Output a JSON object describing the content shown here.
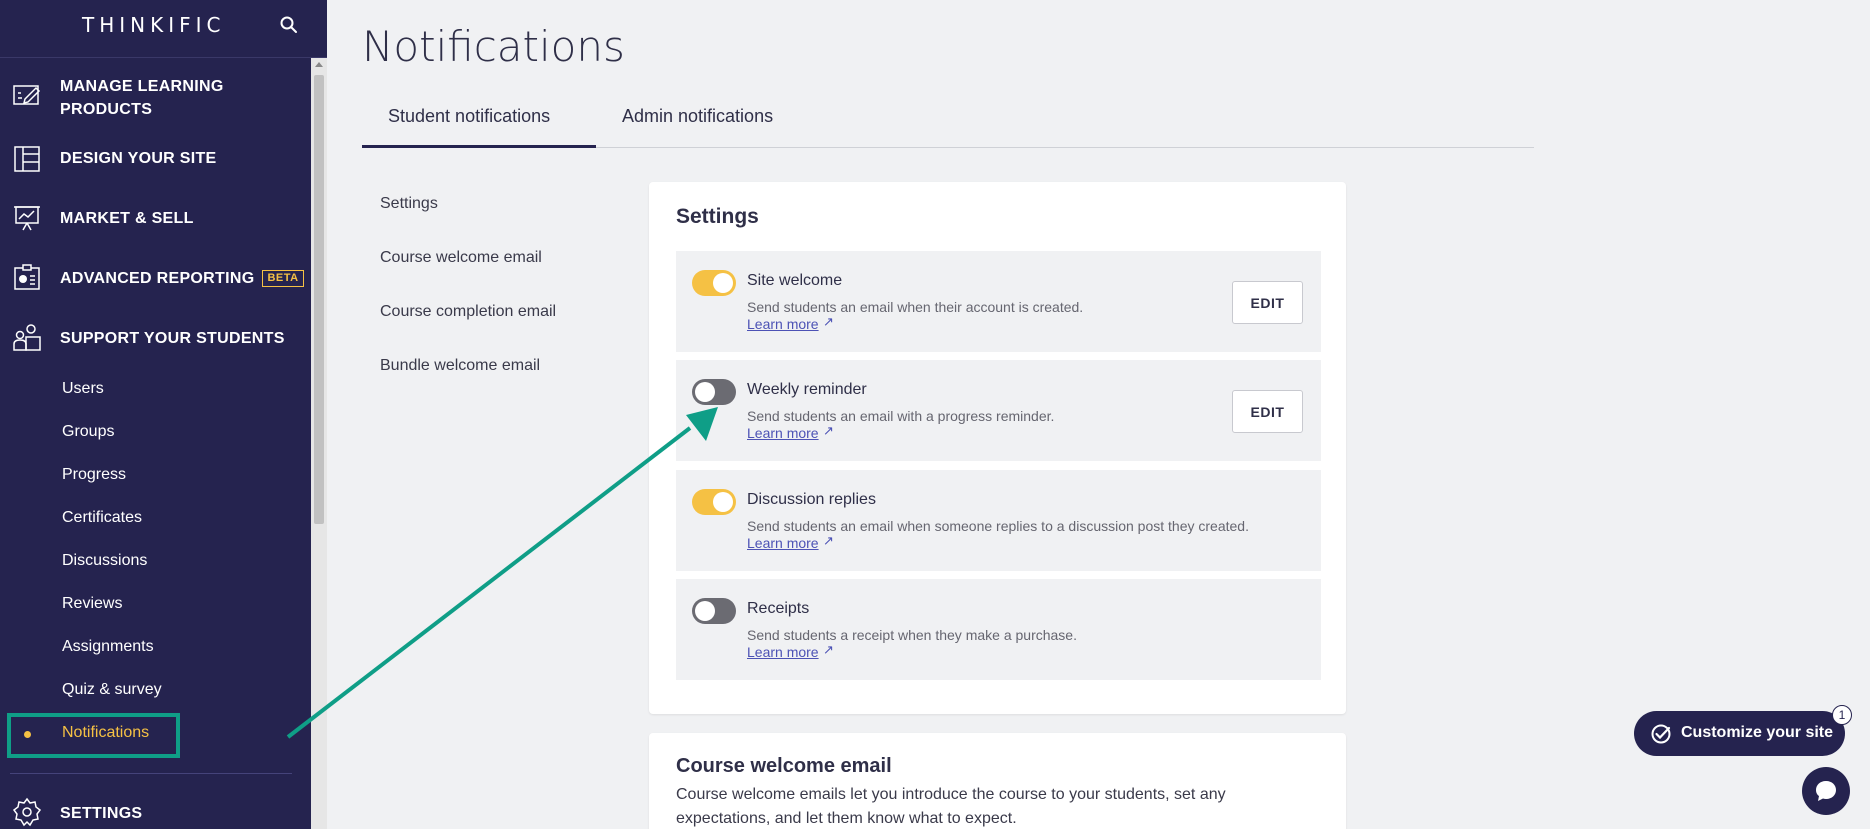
{
  "brand": {
    "name": "THINKIFIC"
  },
  "sidebar": {
    "sections": [
      {
        "label_line1": "MANAGE LEARNING",
        "label_line2": "PRODUCTS",
        "icon": "edit-board-icon"
      },
      {
        "label": "DESIGN YOUR SITE",
        "icon": "layout-icon"
      },
      {
        "label": "MARKET & SELL",
        "icon": "chart-presentation-icon"
      },
      {
        "label": "ADVANCED REPORTING",
        "badge": "BETA",
        "icon": "report-icon"
      },
      {
        "label": "SUPPORT YOUR STUDENTS",
        "icon": "students-icon"
      }
    ],
    "sub_items": [
      "Users",
      "Groups",
      "Progress",
      "Certificates",
      "Discussions",
      "Reviews",
      "Assignments",
      "Quiz & survey",
      "Notifications"
    ],
    "active_item": "Notifications",
    "settings_label": "SETTINGS"
  },
  "page": {
    "title": "Notifications",
    "tabs": [
      {
        "label": "Student notifications",
        "active": true
      },
      {
        "label": "Admin notifications",
        "active": false
      }
    ],
    "left_nav": [
      "Settings",
      "Course welcome email",
      "Course completion email",
      "Bundle welcome email"
    ]
  },
  "settings_card": {
    "title": "Settings",
    "rows": [
      {
        "title": "Site welcome",
        "desc": "Send students an email when their account is created.",
        "link": "Learn more",
        "enabled": true,
        "edit": "EDIT"
      },
      {
        "title": "Weekly reminder",
        "desc": "Send students an email with a progress reminder.",
        "link": "Learn more",
        "enabled": false,
        "edit": "EDIT"
      },
      {
        "title": "Discussion replies",
        "desc": "Send students an email when someone replies to a discussion post they created.",
        "link": "Learn more",
        "enabled": true
      },
      {
        "title": "Receipts",
        "desc": "Send students a receipt when they make a purchase.",
        "link": "Learn more",
        "enabled": false
      }
    ]
  },
  "course_welcome_card": {
    "title": "Course welcome email",
    "desc": "Course welcome emails let you introduce the course to your students, set any expectations, and let them know what to expect."
  },
  "floating": {
    "customize_label": "Customize your site",
    "badge_count": "1"
  },
  "colors": {
    "sidebar_bg": "#25234f",
    "accent_yellow": "#f5c144",
    "annotation_green": "#0f9e87",
    "link_blue": "#4c52b5"
  }
}
